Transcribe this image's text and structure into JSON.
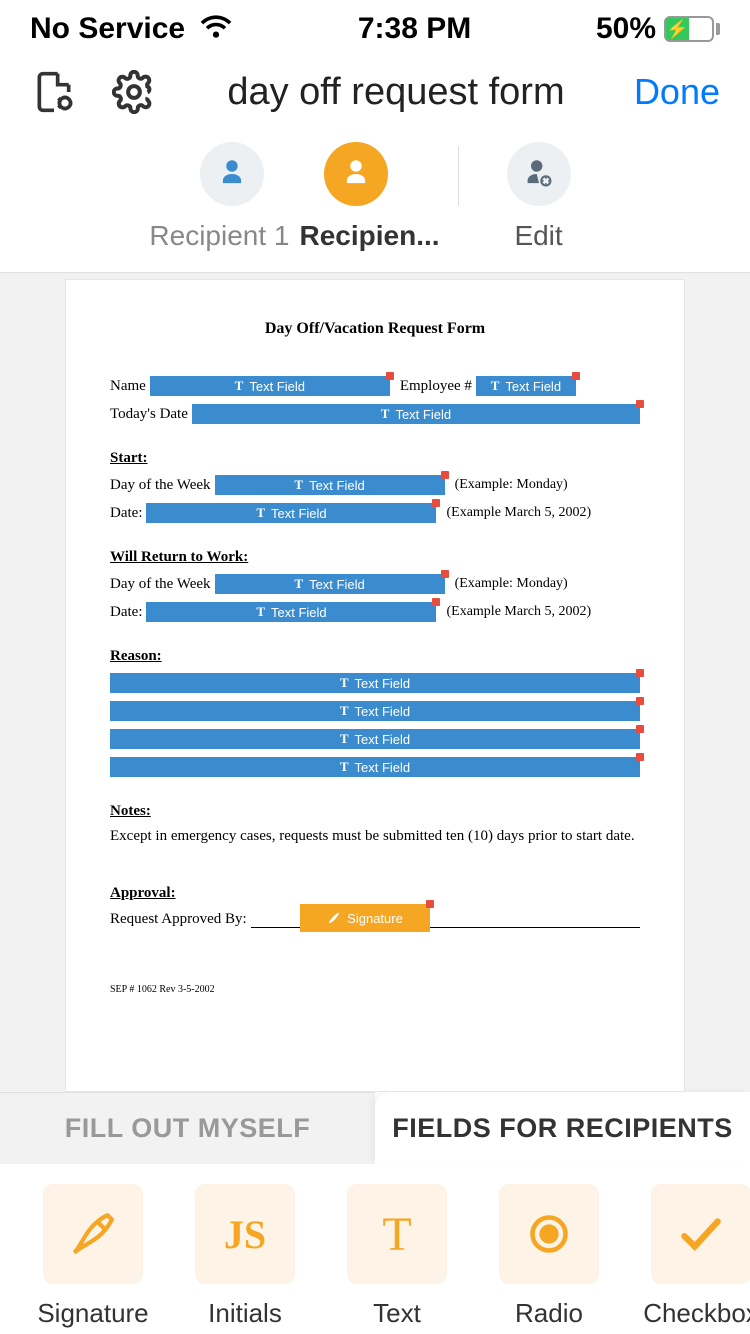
{
  "status": {
    "service": "No Service",
    "time": "7:38 PM",
    "battery_pct": "50%"
  },
  "nav": {
    "title": "day off request form",
    "done": "Done"
  },
  "recipients": {
    "r1_label": "Recipient 1",
    "r2_label": "Recipien...",
    "edit_label": "Edit"
  },
  "doc": {
    "title": "Day Off/Vacation Request Form",
    "name_label": "Name",
    "employee_label": "Employee #",
    "today_label": "Today's Date",
    "start_heading": "Start:",
    "dow_label": "Day of the Week",
    "date_label": "Date:",
    "dow_hint": "(Example: Monday)",
    "date_hint": "(Example March 5, 2002)",
    "return_heading": "Will Return to Work:",
    "reason_heading": "Reason:",
    "notes_heading": "Notes:",
    "notes_text": "Except in emergency cases, requests must be submitted ten (10) days prior to start date.",
    "approval_heading": "Approval:",
    "approved_by": "Request Approved By:",
    "text_field_label": "Text Field",
    "signature_label": "Signature",
    "footer": "SEP # 1062 Rev 3-5-2002"
  },
  "mode_tabs": {
    "self": "FILL OUT MYSELF",
    "recipients": "FIELDS FOR RECIPIENTS"
  },
  "tools": {
    "signature": "Signature",
    "initials": "Initials",
    "text": "Text",
    "radio": "Radio",
    "checkbox": "Checkbox"
  }
}
